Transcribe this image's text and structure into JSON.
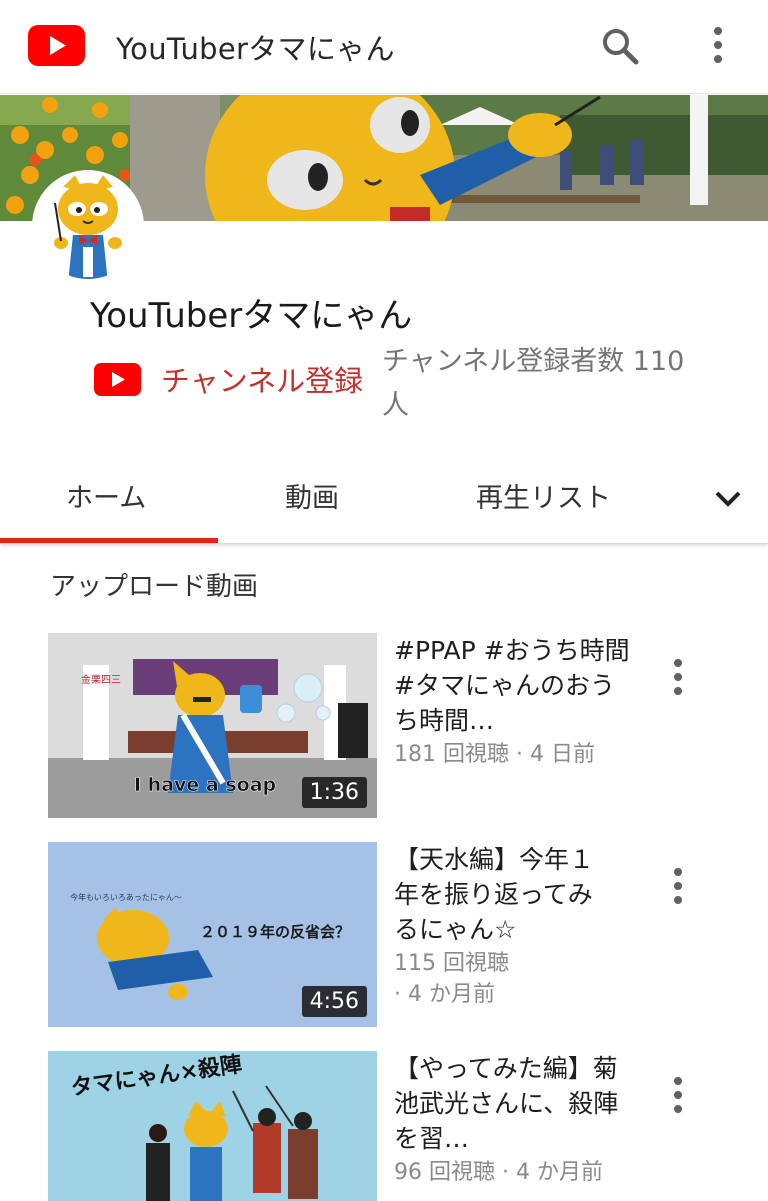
{
  "appbar": {
    "title": "YouTuberタマにゃん",
    "icons": [
      "youtube-logo-icon",
      "search-icon",
      "more-vert-icon"
    ]
  },
  "channel": {
    "name": "YouTuberタマにゃん",
    "subscribe_label": "チャンネル登録",
    "subscriber_count": "チャンネル登録者数 110 人"
  },
  "tabs": [
    {
      "label": "ホーム",
      "selected": true
    },
    {
      "label": "動画",
      "selected": false
    },
    {
      "label": "再生リスト",
      "selected": false
    }
  ],
  "section": {
    "title": "アップロード動画"
  },
  "videos": [
    {
      "title": "#PPAP #おうち時間 #タマにゃんのおうち時間…",
      "meta_line1": "181 回視聴 · 4 日前",
      "meta_line2": "",
      "duration": "1:36",
      "thumb_caption": "I have a soap",
      "banner_text": "金栗四三"
    },
    {
      "title": "【天水編】今年１年を振り返ってみるにゃん☆",
      "meta_line1": "115 回視聴",
      "meta_line2": "· 4 か月前",
      "duration": "4:56",
      "thumb_caption": "２０１９年の反省会？",
      "thumb_small_text": "今年もいろいろあったにゃん～"
    },
    {
      "title": "【やってみた編】菊池武光さんに、殺陣を習…",
      "meta_line1": "96 回視聴 · 4 か月前",
      "meta_line2": "",
      "thumb_caption": "タマにゃん×殺陣"
    }
  ],
  "colors": {
    "brand_red": "#ff0000",
    "subscribe_red": "#c4302b",
    "tab_indicator": "#e62117"
  }
}
